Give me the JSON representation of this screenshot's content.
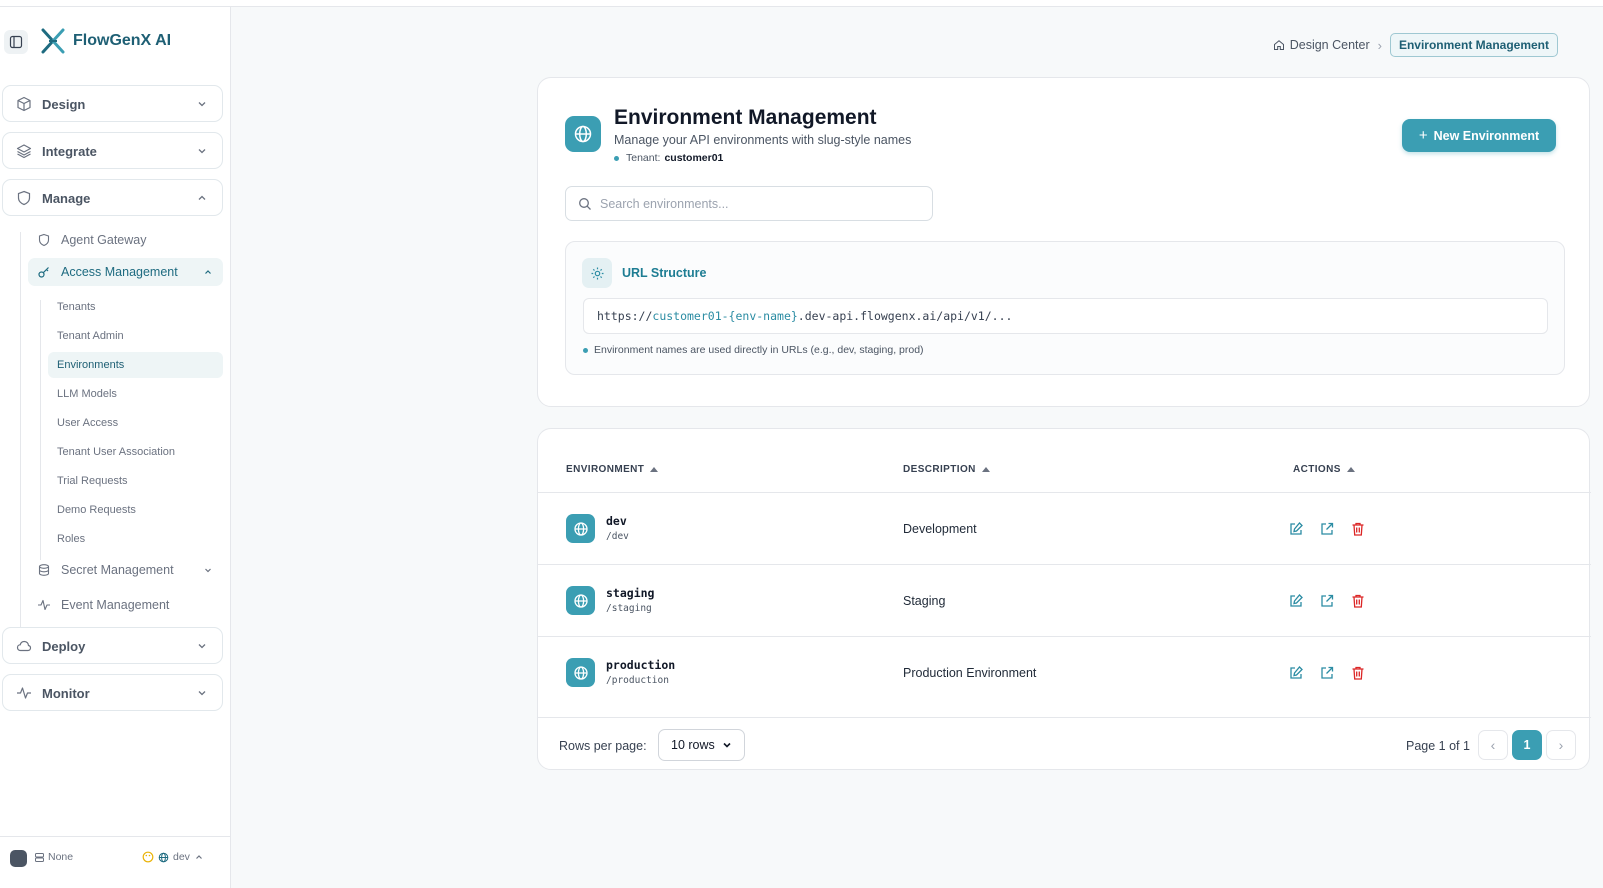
{
  "app": {
    "name": "FlowGenX AI"
  },
  "sidebar": {
    "groups": {
      "design": {
        "label": "Design"
      },
      "integrate": {
        "label": "Integrate"
      },
      "manage": {
        "label": "Manage"
      },
      "deploy": {
        "label": "Deploy"
      },
      "monitor": {
        "label": "Monitor"
      }
    },
    "manage_items": {
      "agent_gateway": "Agent Gateway",
      "access_management": "Access Management",
      "secret_management": "Secret Management",
      "event_management": "Event Management"
    },
    "access_items": [
      "Tenants",
      "Tenant Admin",
      "Environments",
      "LLM Models",
      "User Access",
      "Tenant User Association",
      "Trial Requests",
      "Demo Requests",
      "Roles"
    ],
    "footer": {
      "workspace": "None",
      "env": "dev"
    }
  },
  "breadcrumb": {
    "home": "Design Center",
    "current": "Environment Management"
  },
  "header": {
    "title": "Environment Management",
    "subtitle": "Manage your API environments with slug-style names",
    "tenant_label": "Tenant:",
    "tenant_value": "customer01",
    "new_button": "New Environment"
  },
  "search": {
    "placeholder": "Search environments..."
  },
  "url_structure": {
    "title": "URL Structure",
    "prefix": "https://",
    "highlight": "customer01-{env-name}",
    "suffix": ".dev-api.flowgenx.ai/api/v1/...",
    "note": "Environment names are used directly in URLs (e.g., dev, staging, prod)"
  },
  "table": {
    "headers": {
      "environment": "ENVIRONMENT",
      "description": "DESCRIPTION",
      "actions": "ACTIONS"
    },
    "rows": [
      {
        "name": "dev",
        "path": "/dev",
        "description": "Development"
      },
      {
        "name": "staging",
        "path": "/staging",
        "description": "Staging"
      },
      {
        "name": "production",
        "path": "/production",
        "description": "Production Environment"
      }
    ],
    "footer": {
      "rows_per_page_label": "Rows per page:",
      "rows_per_page_value": "10 rows",
      "page_info": "Page 1 of 1",
      "current_page": "1"
    }
  },
  "colors": {
    "accent": "#3b9eb3",
    "brand_text": "#1e5f74",
    "danger": "#dc2626"
  }
}
